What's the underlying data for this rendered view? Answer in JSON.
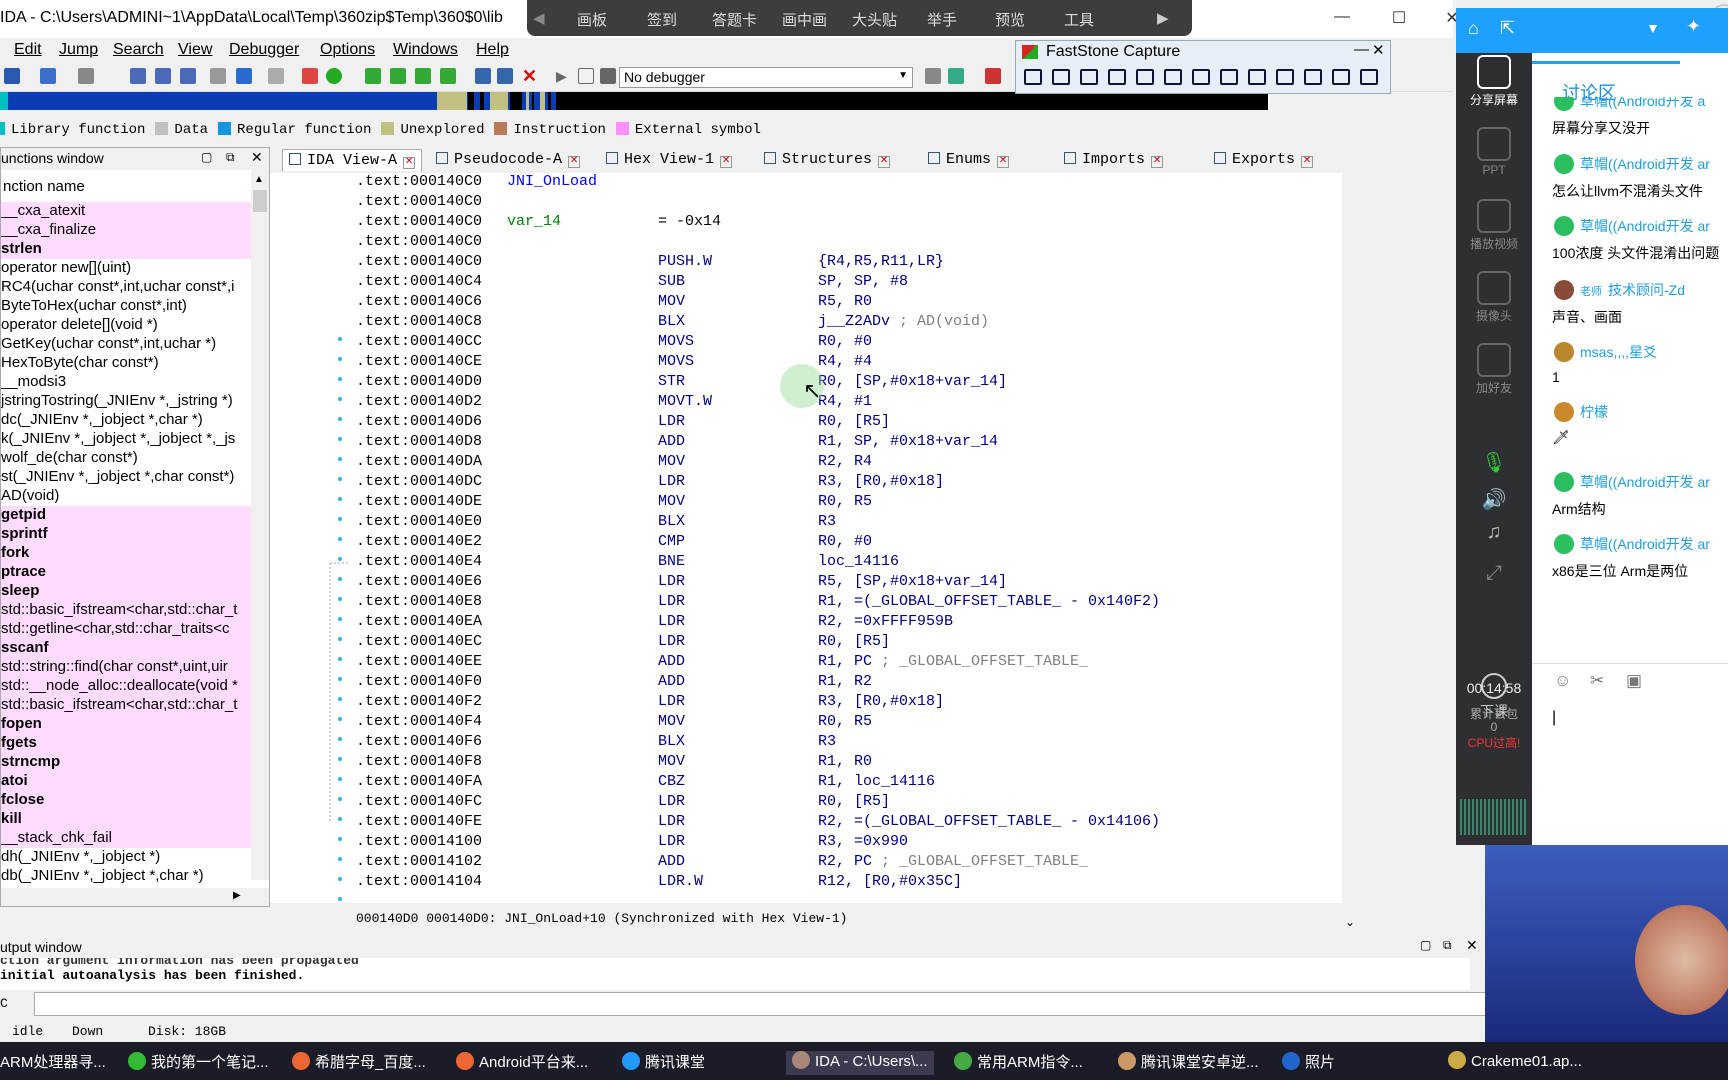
{
  "window": {
    "title": "IDA - C:\\Users\\ADMINI~1\\AppData\\Local\\Temp\\360zip$Temp\\360$0\\lib"
  },
  "recorder_bar": {
    "items": [
      "画板",
      "签到",
      "答题卡",
      "画中画",
      "大头贴",
      "举手",
      "预览",
      "工具"
    ]
  },
  "menu": [
    "Edit",
    "Jump",
    "Search",
    "View",
    "Debugger",
    "Options",
    "Windows",
    "Help"
  ],
  "toolbar": {
    "debugger_select": "No debugger"
  },
  "legend": [
    {
      "label": "Library function",
      "color": "#00c0c0"
    },
    {
      "label": "Data",
      "color": "#c0c0c0"
    },
    {
      "label": "Regular function",
      "color": "#1096dc"
    },
    {
      "label": "Unexplored",
      "color": "#c0c080"
    },
    {
      "label": "Instruction",
      "color": "#b87a5a"
    },
    {
      "label": "External symbol",
      "color": "#ff90ff"
    }
  ],
  "faststone": {
    "title": "FastStone Capture"
  },
  "functions_window": {
    "title": "unctions window",
    "column": "nction name",
    "items": [
      {
        "name": "__cxa_atexit",
        "pink": true,
        "bold": false
      },
      {
        "name": "__cxa_finalize",
        "pink": true,
        "bold": false
      },
      {
        "name": "strlen",
        "pink": true,
        "bold": true
      },
      {
        "name": "operator new[](uint)",
        "pink": false,
        "bold": false
      },
      {
        "name": "RC4(uchar const*,int,uchar const*,i",
        "pink": false,
        "bold": false
      },
      {
        "name": "ByteToHex(uchar const*,int)",
        "pink": false,
        "bold": false
      },
      {
        "name": "operator delete[](void *)",
        "pink": false,
        "bold": false
      },
      {
        "name": "GetKey(uchar const*,int,uchar *)",
        "pink": false,
        "bold": false
      },
      {
        "name": "HexToByte(char const*)",
        "pink": false,
        "bold": false
      },
      {
        "name": "__modsi3",
        "pink": false,
        "bold": false
      },
      {
        "name": "jstringTostring(_JNIEnv *,_jstring *)",
        "pink": false,
        "bold": false
      },
      {
        "name": "dc(_JNIEnv *,_jobject *,char *)",
        "pink": false,
        "bold": false
      },
      {
        "name": "k(_JNIEnv *,_jobject *,_jobject *,_js",
        "pink": false,
        "bold": false
      },
      {
        "name": "wolf_de(char const*)",
        "pink": false,
        "bold": false
      },
      {
        "name": "st(_JNIEnv *,_jobject *,char const*)",
        "pink": false,
        "bold": false
      },
      {
        "name": "AD(void)",
        "pink": false,
        "bold": false
      },
      {
        "name": "getpid",
        "pink": true,
        "bold": true
      },
      {
        "name": "sprintf",
        "pink": true,
        "bold": true
      },
      {
        "name": "fork",
        "pink": true,
        "bold": true
      },
      {
        "name": "ptrace",
        "pink": true,
        "bold": true
      },
      {
        "name": "sleep",
        "pink": true,
        "bold": true
      },
      {
        "name": "std::basic_ifstream<char,std::char_t",
        "pink": true,
        "bold": false
      },
      {
        "name": "std::getline<char,std::char_traits<c",
        "pink": true,
        "bold": false
      },
      {
        "name": "sscanf",
        "pink": true,
        "bold": true
      },
      {
        "name": "std::string::find(char const*,uint,uir",
        "pink": true,
        "bold": false
      },
      {
        "name": "std::__node_alloc::deallocate(void *",
        "pink": true,
        "bold": false
      },
      {
        "name": "std::basic_ifstream<char,std::char_t",
        "pink": true,
        "bold": false
      },
      {
        "name": "fopen",
        "pink": true,
        "bold": true
      },
      {
        "name": "fgets",
        "pink": true,
        "bold": true
      },
      {
        "name": "strncmp",
        "pink": true,
        "bold": true
      },
      {
        "name": "atoi",
        "pink": true,
        "bold": true
      },
      {
        "name": "fclose",
        "pink": true,
        "bold": true
      },
      {
        "name": "kill",
        "pink": true,
        "bold": true
      },
      {
        "name": "__stack_chk_fail",
        "pink": true,
        "bold": false
      },
      {
        "name": "dh(_JNIEnv *,_jobject *)",
        "pink": false,
        "bold": false
      },
      {
        "name": "db(_JNIEnv *,_jobject *,char *)",
        "pink": false,
        "bold": false
      }
    ]
  },
  "tabs": [
    {
      "label": "IDA View-A",
      "active": true
    },
    {
      "label": "Pseudocode-A",
      "active": false
    },
    {
      "label": "Hex View-1",
      "active": false
    },
    {
      "label": "Structures",
      "active": false
    },
    {
      "label": "Enums",
      "active": false
    },
    {
      "label": "Imports",
      "active": false
    },
    {
      "label": "Exports",
      "active": false
    }
  ],
  "code": [
    {
      "addr": ".text:000140C0",
      "label": "JNI_OnLoad",
      "mn": "",
      "ops": "",
      "cmt": ""
    },
    {
      "addr": ".text:000140C0",
      "label": "",
      "mn": "",
      "ops": "",
      "cmt": ""
    },
    {
      "addr": ".text:000140C0",
      "label": "var_14",
      "mn": "= -0x14",
      "ops": "",
      "cmt": ""
    },
    {
      "addr": ".text:000140C0",
      "label": "",
      "mn": "",
      "ops": "",
      "cmt": ""
    },
    {
      "addr": ".text:000140C0",
      "label": "",
      "mn": "PUSH.W",
      "ops": "{R4,R5,R11,LR}",
      "cmt": ""
    },
    {
      "addr": ".text:000140C4",
      "label": "",
      "mn": "SUB",
      "ops": "SP, SP, #8",
      "cmt": ""
    },
    {
      "addr": ".text:000140C6",
      "label": "",
      "mn": "MOV",
      "ops": "R5, R0",
      "cmt": ""
    },
    {
      "addr": ".text:000140C8",
      "label": "",
      "mn": "BLX",
      "ops": "j__Z2ADv",
      "cmt": "; AD(void)"
    },
    {
      "addr": ".text:000140CC",
      "label": "",
      "mn": "MOVS",
      "ops": "R0, #0",
      "cmt": ""
    },
    {
      "addr": ".text:000140CE",
      "label": "",
      "mn": "MOVS",
      "ops": "R4, #4",
      "cmt": ""
    },
    {
      "addr": ".text:000140D0",
      "label": "",
      "mn": "STR",
      "ops": "R0, [SP,#0x18+var_14]",
      "cmt": ""
    },
    {
      "addr": ".text:000140D2",
      "label": "",
      "mn": "MOVT.W",
      "ops": "R4, #1",
      "cmt": ""
    },
    {
      "addr": ".text:000140D6",
      "label": "",
      "mn": "LDR",
      "ops": "R0, [R5]",
      "cmt": ""
    },
    {
      "addr": ".text:000140D8",
      "label": "",
      "mn": "ADD",
      "ops": "R1, SP, #0x18+var_14",
      "cmt": ""
    },
    {
      "addr": ".text:000140DA",
      "label": "",
      "mn": "MOV",
      "ops": "R2, R4",
      "cmt": ""
    },
    {
      "addr": ".text:000140DC",
      "label": "",
      "mn": "LDR",
      "ops": "R3, [R0,#0x18]",
      "cmt": ""
    },
    {
      "addr": ".text:000140DE",
      "label": "",
      "mn": "MOV",
      "ops": "R0, R5",
      "cmt": ""
    },
    {
      "addr": ".text:000140E0",
      "label": "",
      "mn": "BLX",
      "ops": "R3",
      "cmt": ""
    },
    {
      "addr": ".text:000140E2",
      "label": "",
      "mn": "CMP",
      "ops": "R0, #0",
      "cmt": ""
    },
    {
      "addr": ".text:000140E4",
      "label": "",
      "mn": "BNE",
      "ops": "loc_14116",
      "cmt": ""
    },
    {
      "addr": ".text:000140E6",
      "label": "",
      "mn": "LDR",
      "ops": "R5, [SP,#0x18+var_14]",
      "cmt": ""
    },
    {
      "addr": ".text:000140E8",
      "label": "",
      "mn": "LDR",
      "ops": "R1, =(_GLOBAL_OFFSET_TABLE_ - 0x140F2)",
      "cmt": ""
    },
    {
      "addr": ".text:000140EA",
      "label": "",
      "mn": "LDR",
      "ops": "R2, =0xFFFF959B",
      "cmt": ""
    },
    {
      "addr": ".text:000140EC",
      "label": "",
      "mn": "LDR",
      "ops": "R0, [R5]",
      "cmt": ""
    },
    {
      "addr": ".text:000140EE",
      "label": "",
      "mn": "ADD",
      "ops": "R1, PC",
      "cmt": "; _GLOBAL_OFFSET_TABLE_"
    },
    {
      "addr": ".text:000140F0",
      "label": "",
      "mn": "ADD",
      "ops": "R1, R2",
      "cmt": ""
    },
    {
      "addr": ".text:000140F2",
      "label": "",
      "mn": "LDR",
      "ops": "R3, [R0,#0x18]",
      "cmt": ""
    },
    {
      "addr": ".text:000140F4",
      "label": "",
      "mn": "MOV",
      "ops": "R0, R5",
      "cmt": ""
    },
    {
      "addr": ".text:000140F6",
      "label": "",
      "mn": "BLX",
      "ops": "R3",
      "cmt": ""
    },
    {
      "addr": ".text:000140F8",
      "label": "",
      "mn": "MOV",
      "ops": "R1, R0",
      "cmt": ""
    },
    {
      "addr": ".text:000140FA",
      "label": "",
      "mn": "CBZ",
      "ops": "R1, loc_14116",
      "cmt": ""
    },
    {
      "addr": ".text:000140FC",
      "label": "",
      "mn": "LDR",
      "ops": "R0, [R5]",
      "cmt": ""
    },
    {
      "addr": ".text:000140FE",
      "label": "",
      "mn": "LDR",
      "ops": "R2, =(_GLOBAL_OFFSET_TABLE_ - 0x14106)",
      "cmt": ""
    },
    {
      "addr": ".text:00014100",
      "label": "",
      "mn": "LDR",
      "ops": "R3, =0x990",
      "cmt": ""
    },
    {
      "addr": ".text:00014102",
      "label": "",
      "mn": "ADD",
      "ops": "R2, PC",
      "cmt": "; _GLOBAL_OFFSET_TABLE_"
    },
    {
      "addr": ".text:00014104",
      "label": "",
      "mn": "LDR.W",
      "ops": "R12, [R0,#0x35C]",
      "cmt": ""
    }
  ],
  "code_status": "000140D0 000140D0: JNI_OnLoad+10 (Synchronized with Hex View-1)",
  "output": {
    "title": "utput window",
    "lines": [
      "ction argument information has been propagated",
      " initial autoanalysis has been finished."
    ],
    "prompt": "C"
  },
  "statusbar": {
    "state": "idle",
    "dir": "Down",
    "disk": "Disk: 18GB"
  },
  "taskbar": [
    {
      "label": "ARM处理器寻...",
      "color": "#8a6"
    },
    {
      "label": "我的第一个笔记...",
      "color": "#3b3"
    },
    {
      "label": "希腊字母_百度...",
      "color": "#e63"
    },
    {
      "label": "Android平台来...",
      "color": "#e63"
    },
    {
      "label": "腾讯课堂",
      "color": "#29f"
    },
    {
      "label": "IDA - C:\\Users\\...",
      "color": "#a87"
    },
    {
      "label": "常用ARM指令...",
      "color": "#4a4"
    },
    {
      "label": "腾讯课堂安卓逆...",
      "color": "#c96"
    },
    {
      "label": "照片",
      "color": "#26c"
    },
    {
      "label": "Crakeme01.ap...",
      "color": "#ca4"
    }
  ],
  "qq": {
    "side": [
      {
        "label": "分享屏幕",
        "active": true
      },
      {
        "label": "PPT",
        "active": false
      },
      {
        "label": "播放视频",
        "active": false
      },
      {
        "label": "摄像头",
        "active": false
      },
      {
        "label": "加好友",
        "active": false
      }
    ],
    "end_class": "下课",
    "timer": "00:14:58",
    "lost": "累计丢包",
    "lost_count": "0",
    "cpu": "CPU过高!",
    "panel_title": "讨论区",
    "messages": [
      {
        "name": "草帽((Android开发 a",
        "text": "屏幕分享又没开",
        "color": "#2bbf5f"
      },
      {
        "name": "草帽((Android开发 ar",
        "text": "怎么让llvm不混淆头文件",
        "color": "#2bbf5f"
      },
      {
        "name": "草帽((Android开发 ar",
        "text": "100浓度  头文件混淆出问题",
        "color": "#2bbf5f"
      },
      {
        "name": "技术顾问-Zd",
        "text": "声音、画面",
        "color": "#8a4a3a",
        "badge": "老师"
      },
      {
        "name": "msas,,,,星爻",
        "text": "1",
        "color": "#b8862b"
      },
      {
        "name": "柠檬",
        "text": "🗡",
        "color": "#c8882b"
      },
      {
        "name": "草帽((Android开发 ar",
        "text": "Arm结构",
        "color": "#2bbf5f"
      },
      {
        "name": "草帽((Android开发 ar",
        "text": "x86是三位  Arm是两位",
        "color": "#2bbf5f"
      }
    ]
  }
}
